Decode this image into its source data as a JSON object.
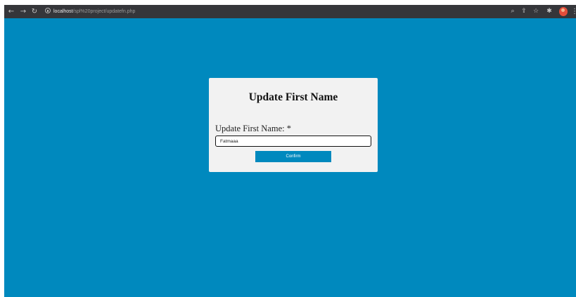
{
  "browser": {
    "url_host": "localhost",
    "url_path": "/spl%20project/updatefn.php",
    "icons": {
      "back": "arrow-left-icon",
      "forward": "arrow-right-icon",
      "reload": "reload-icon",
      "site_info": "info-icon",
      "zoom": "magnifier-icon",
      "share": "share-icon",
      "bookmark": "star-icon",
      "extensions": "puzzle-icon",
      "profile": "avatar",
      "menu": "kebab-menu-icon"
    },
    "colors": {
      "toolbar": "#35363a",
      "page_background": "#0089be"
    }
  },
  "form": {
    "title": "Update First Name",
    "field_label": "Update First Name: *",
    "field_value": "Fatmaaa",
    "submit_label": "Confirm",
    "colors": {
      "card": "#f2f2f2",
      "button": "#0089be"
    }
  }
}
